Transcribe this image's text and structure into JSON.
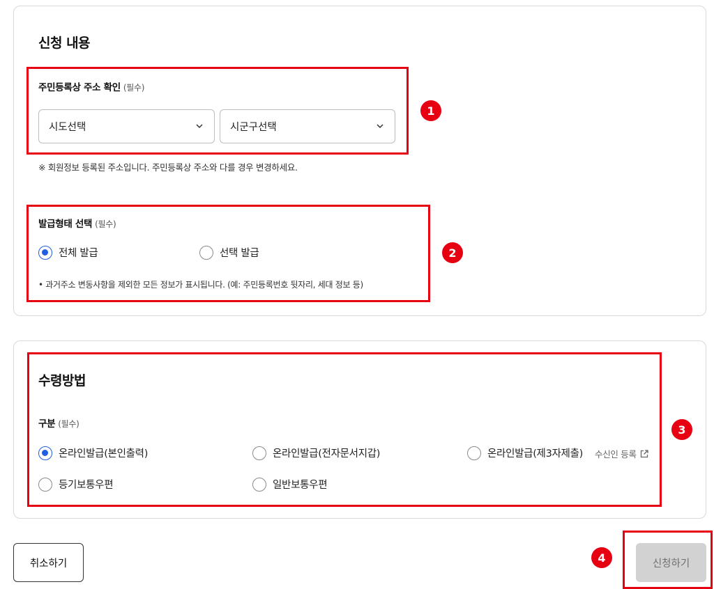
{
  "application": {
    "title": "신청 내용",
    "address": {
      "label": "주민등록상 주소 확인",
      "required": "(필수)",
      "sido": {
        "value": "시도선택"
      },
      "sigungu": {
        "value": "시군구선택"
      },
      "note": "※ 회원정보 등록된 주소입니다. 주민등록상 주소와 다를 경우 변경하세요."
    },
    "issue_type": {
      "label": "발급형태 선택",
      "required": "(필수)",
      "options": [
        {
          "label": "전체 발급",
          "selected": true
        },
        {
          "label": "선택 발급",
          "selected": false
        }
      ],
      "note": "• 과거주소 변동사항을 제외한 모든 정보가 표시됩니다. (예: 주민등록번호 뒷자리, 세대 정보 등)"
    }
  },
  "receipt": {
    "title": "수령방법",
    "category": {
      "label": "구분",
      "required": "(필수)",
      "options": [
        {
          "label": "온라인발급(본인출력)",
          "selected": true
        },
        {
          "label": "온라인발급(전자문서지갑)",
          "selected": false
        },
        {
          "label": "온라인발급(제3자제출)",
          "selected": false
        },
        {
          "label": "등기보통우편",
          "selected": false
        },
        {
          "label": "일반보통우편",
          "selected": false
        }
      ],
      "recipient_link": "수신인 등록"
    }
  },
  "actions": {
    "cancel": "취소하기",
    "submit": "신청하기"
  },
  "annotations": {
    "badges": [
      "1",
      "2",
      "3",
      "4"
    ],
    "color": "#e60012"
  },
  "colors": {
    "accent": "#1f5fe0",
    "disabled_button": "#d2d2d2"
  }
}
